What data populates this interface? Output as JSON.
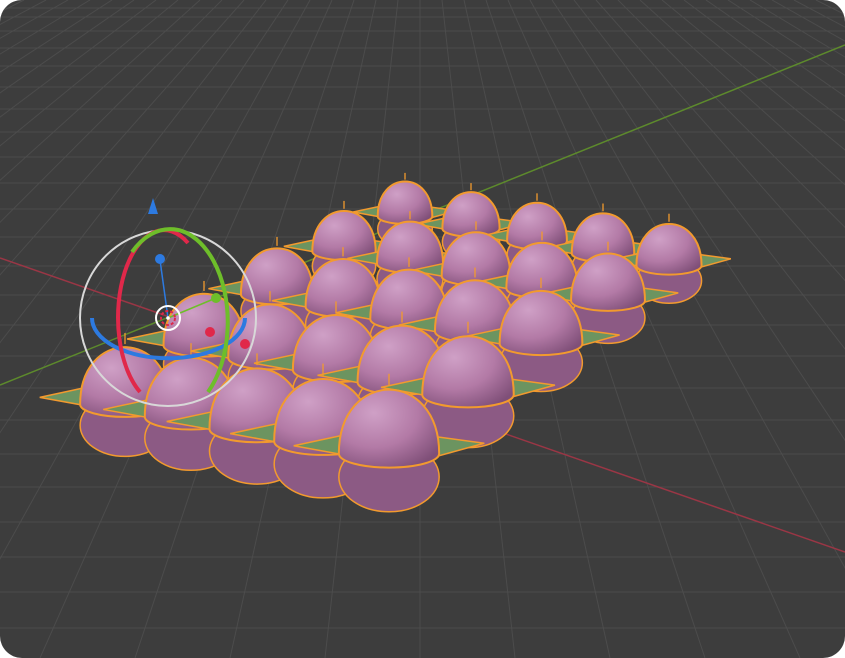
{
  "viewport": {
    "background": "#3d3d3d",
    "grid_color": "#4c4c4c",
    "x_axis_color": "#9a3645",
    "y_axis_color": "#5d8a2c"
  },
  "scene": {
    "egg_body": "#b37aa6",
    "egg_shade": "#8c5a84",
    "egg_highlight": "#c995bd",
    "outline": "#f29a2e",
    "plane_fill": "#6c9460",
    "selection_count": 25
  },
  "gizmo": {
    "type": "rotate",
    "ring_color": "#d8d8d8",
    "x_color": "#e0284a",
    "y_color": "#6ebe2a",
    "z_color": "#2d7ae0",
    "icons": [
      "z-axis-arrow-icon",
      "pivot-icon"
    ]
  }
}
